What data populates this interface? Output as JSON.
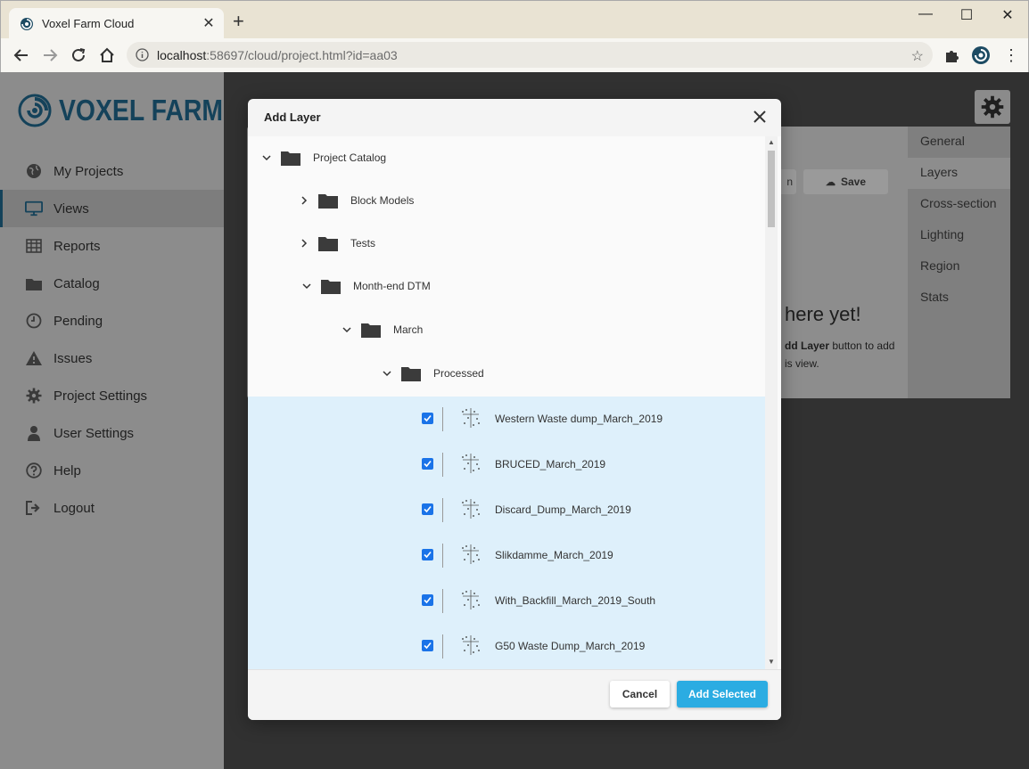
{
  "browser": {
    "tab_title": "Voxel Farm Cloud",
    "url_host": "localhost",
    "url_path": ":58697/cloud/project.html?id=aa03"
  },
  "app": {
    "logo_text": "VOXEL FARM",
    "brand_color": "#14425a",
    "menu": [
      {
        "label": "My Projects",
        "icon": "globe-icon"
      },
      {
        "label": "Views",
        "icon": "monitor-icon"
      },
      {
        "label": "Reports",
        "icon": "table-icon"
      },
      {
        "label": "Catalog",
        "icon": "folder-icon"
      },
      {
        "label": "Pending",
        "icon": "clock-icon"
      },
      {
        "label": "Issues",
        "icon": "warning-icon"
      },
      {
        "label": "Project Settings",
        "icon": "gear-icon"
      },
      {
        "label": "User Settings",
        "icon": "user-icon"
      },
      {
        "label": "Help",
        "icon": "help-icon"
      },
      {
        "label": "Logout",
        "icon": "logout-icon"
      }
    ],
    "active_menu": "Views"
  },
  "panel": {
    "tabs": [
      "General",
      "Layers",
      "Cross-section",
      "Lighting",
      "Region",
      "Stats"
    ],
    "selected_tab": "Layers",
    "save_label": "Save",
    "empty_title": "here yet!",
    "empty_line1_bold": "dd Layer",
    "empty_line1_rest": " button to add",
    "empty_line2": "is view."
  },
  "modal": {
    "title": "Add Layer",
    "tree": [
      {
        "label": "Project Catalog",
        "expanded": true
      },
      {
        "label": "Block Models",
        "expanded": false
      },
      {
        "label": "Tests",
        "expanded": false
      },
      {
        "label": "Month-end DTM",
        "expanded": true
      },
      {
        "label": "March",
        "expanded": true
      },
      {
        "label": "Processed",
        "expanded": true
      }
    ],
    "layers": [
      {
        "label": "Western Waste dump_March_2019",
        "checked": true
      },
      {
        "label": "BRUCED_March_2019",
        "checked": true
      },
      {
        "label": "Discard_Dump_March_2019",
        "checked": true
      },
      {
        "label": "Slikdamme_March_2019",
        "checked": true
      },
      {
        "label": "With_Backfill_March_2019_South",
        "checked": true
      },
      {
        "label": "G50 Waste Dump_March_2019",
        "checked": true
      }
    ],
    "cancel_label": "Cancel",
    "add_label": "Add Selected",
    "accent_color": "#2bace2",
    "selection_color": "#def0fb"
  }
}
